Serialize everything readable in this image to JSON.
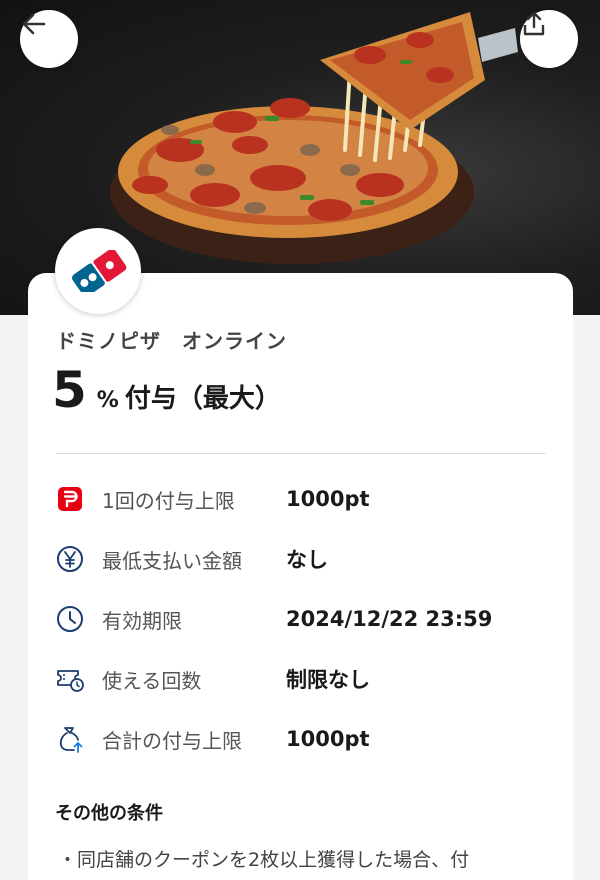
{
  "header": {
    "back_icon": "arrow-left-icon",
    "share_icon": "share-icon"
  },
  "coupon": {
    "merchant": "ドミノピザ　オンライン",
    "rate_value": "5",
    "rate_unit": "%",
    "rate_text": "付与（最大）",
    "brand_colors": {
      "red": "#e31837",
      "blue": "#006491"
    }
  },
  "details": [
    {
      "icon": "paypay-icon",
      "label": "1回の付与上限",
      "value": "1000pt"
    },
    {
      "icon": "yen-icon",
      "label": "最低支払い金額",
      "value": "なし"
    },
    {
      "icon": "clock-icon",
      "label": "有効期限",
      "value": "2024/12/22 23:59"
    },
    {
      "icon": "ticket-icon",
      "label": "使える回数",
      "value": "制限なし"
    },
    {
      "icon": "points-bag-icon",
      "label": "合計の付与上限",
      "value": "1000pt"
    }
  ],
  "conditions": {
    "title": "その他の条件",
    "items": [
      "・同店舗のクーポンを2枚以上獲得した場合、付"
    ]
  },
  "colors": {
    "accent_red": "#e60012",
    "icon_navy": "#1c3d6e"
  }
}
